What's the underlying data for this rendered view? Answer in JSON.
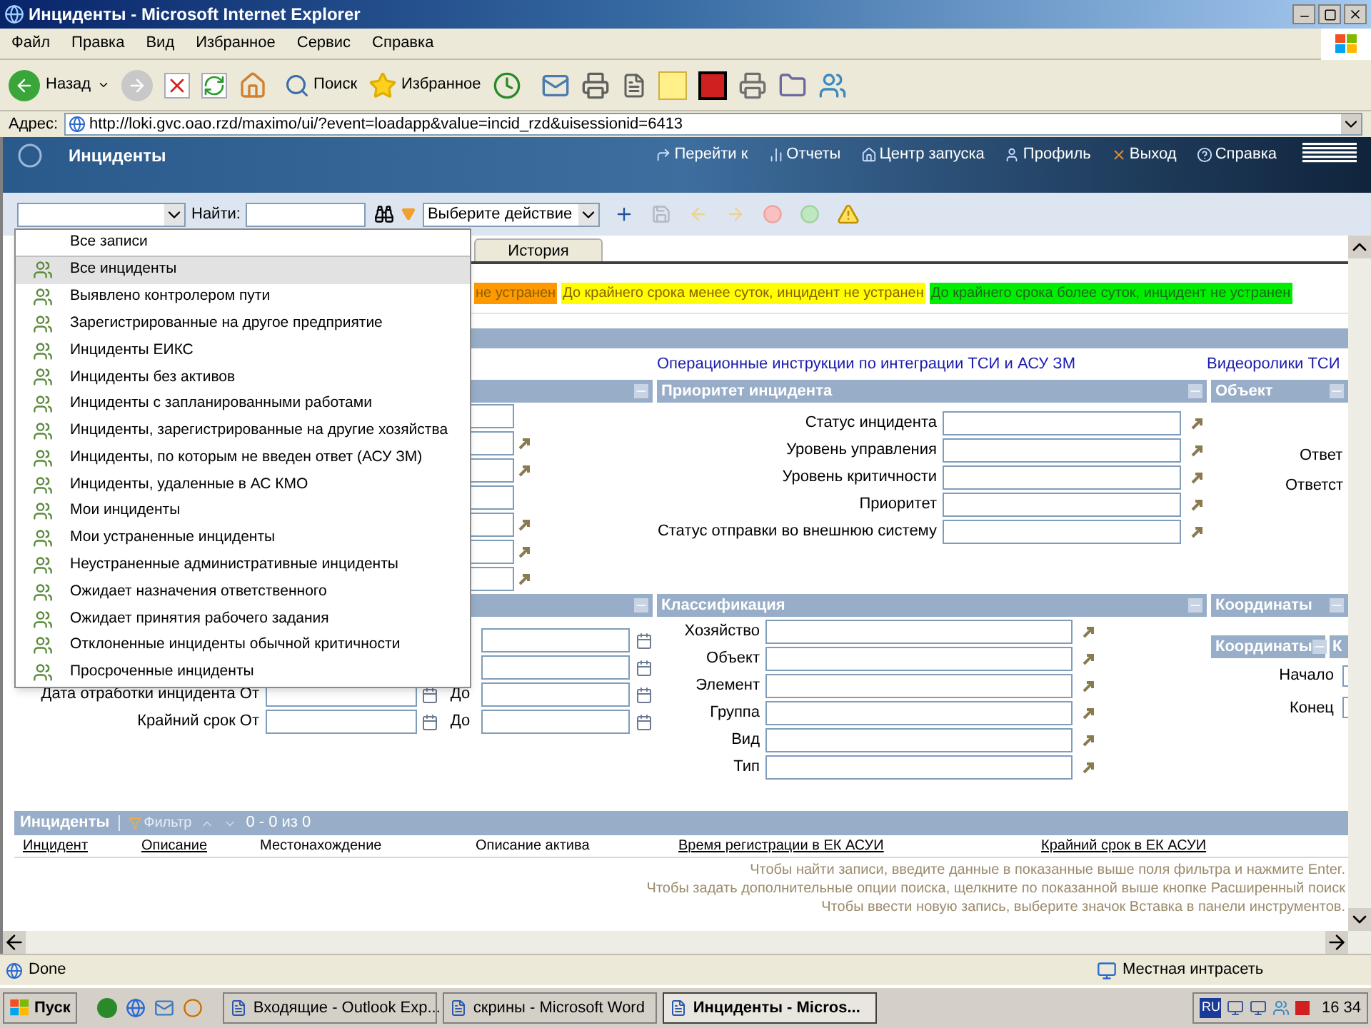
{
  "window": {
    "title": "Инциденты - Microsoft Internet Explorer"
  },
  "menu": [
    "Файл",
    "Правка",
    "Вид",
    "Избранное",
    "Сервис",
    "Справка"
  ],
  "ie_toolbar": {
    "back": "Назад",
    "search": "Поиск",
    "favorites": "Избранное"
  },
  "address": {
    "label": "Адрес:",
    "url": "http://loki.gvc.oao.rzd/maximo/ui/?event=loadapp&value=incid_rzd&uisessionid=6413"
  },
  "app_header": {
    "title": "Инциденты",
    "links": [
      {
        "label": "Перейти к",
        "kind": "goto"
      },
      {
        "label": "Отчеты",
        "kind": "reports"
      },
      {
        "label": "Центр запуска",
        "kind": "home"
      },
      {
        "label": "Профиль",
        "kind": "profile"
      },
      {
        "label": "Выход",
        "kind": "exit"
      },
      {
        "label": "Справка",
        "kind": "help"
      }
    ]
  },
  "app_toolbar": {
    "find_label": "Найти:",
    "action_select": "Выберите действие"
  },
  "tabs": [
    {
      "label": "История",
      "selected": false
    }
  ],
  "legend": [
    {
      "text": "не устранен",
      "color": "#ff9900"
    },
    {
      "text": "До крайнего срока менее суток, инцидент не устранен",
      "color": "#ffff00"
    },
    {
      "text": "До крайнего срока более суток, инцидент не устранен",
      "color": "#00ee00"
    }
  ],
  "links": [
    "Операционные инструкции по интеграции ТСИ и АСУ ЗМ",
    "Видеоролики ТСИ"
  ],
  "left_fields": [
    {
      "lookup": false
    },
    {
      "lookup": true
    },
    {
      "lookup": true
    },
    {
      "lookup": false
    },
    {
      "lookup": true
    },
    {
      "lookup": true
    },
    {
      "lookup": true
    }
  ],
  "priority_section": {
    "title": "Приоритет инцидента",
    "fields": [
      "Статус инцидента",
      "Уровень управления",
      "Уровень критичности",
      "Приоритет",
      "Статус отправки во внешнюю систему"
    ]
  },
  "object_section": {
    "title": "Объект",
    "labels": [
      "Ответ",
      "Ответст"
    ]
  },
  "date_rows": [
    {
      "kind": "partial"
    },
    {
      "kind": "partial"
    },
    {
      "kind": "range",
      "label": "Дата отработки инцидента От",
      "to": "До"
    },
    {
      "kind": "range",
      "label": "Крайний срок От",
      "to": "До"
    }
  ],
  "classification_section": {
    "title": "Классификация",
    "fields": [
      "Хозяйство",
      "Объект",
      "Элемент",
      "Группа",
      "Вид",
      "Тип"
    ]
  },
  "coordinates_section": {
    "title": "Координаты",
    "sub_title": "Координаты",
    "sub_title_2": "К",
    "labels": [
      "Начало",
      "Конец"
    ]
  },
  "list": {
    "title": "Инциденты",
    "filter": "Фильтр",
    "count": "0 - 0 из 0",
    "columns": [
      {
        "label": "Инцидент",
        "sortable": true
      },
      {
        "label": "Описание",
        "sortable": true
      },
      {
        "label": "Местонахождение",
        "sortable": false
      },
      {
        "label": "Описание актива",
        "sortable": false
      },
      {
        "label": "Время регистрации в ЕК АСУИ",
        "sortable": true
      },
      {
        "label": "Крайний срок в ЕК АСУИ",
        "sortable": true
      }
    ],
    "messages": [
      "Чтобы найти записи, введите данные в показанные выше поля фильтра и нажмите Enter.",
      "Чтобы задать дополнительные опции поиска, щелкните по показанной выше кнопке Расширенный поиск",
      "Чтобы ввести новую запись, выберите значок Вставка в панели инструментов."
    ]
  },
  "dropdown": {
    "items": [
      {
        "label": "Все записи",
        "kind": "plain",
        "selected": false
      },
      {
        "label": "Все инциденты",
        "kind": "query",
        "selected": true
      },
      {
        "label": "Выявлено контролером пути",
        "kind": "query",
        "selected": false
      },
      {
        "label": "Зарегистрированные на другое предприятие",
        "kind": "query",
        "selected": false
      },
      {
        "label": "Инциденты ЕИКС",
        "kind": "query",
        "selected": false
      },
      {
        "label": "Инциденты без активов",
        "kind": "query",
        "selected": false
      },
      {
        "label": "Инциденты с запланированными работами",
        "kind": "query",
        "selected": false
      },
      {
        "label": "Инциденты, зарегистрированные на другие хозяйства",
        "kind": "query",
        "selected": false
      },
      {
        "label": "Инциденты, по которым не введен ответ (АСУ ЗМ)",
        "kind": "query",
        "selected": false
      },
      {
        "label": "Инциденты, удаленные в АС КМО",
        "kind": "query",
        "selected": false
      },
      {
        "label": "Мои инциденты",
        "kind": "query",
        "selected": false
      },
      {
        "label": "Мои устраненные инциденты",
        "kind": "query",
        "selected": false
      },
      {
        "label": "Неустраненные административные инциденты",
        "kind": "query",
        "selected": false
      },
      {
        "label": "Ожидает назначения ответственного",
        "kind": "query",
        "selected": false
      },
      {
        "label": "Ожидает принятия рабочего задания",
        "kind": "query",
        "selected": false
      },
      {
        "label": "Отклоненные инциденты обычной критичности",
        "kind": "query",
        "selected": false
      },
      {
        "label": "Просроченные инциденты",
        "kind": "query",
        "selected": false
      }
    ]
  },
  "status_bar": {
    "text": "Done",
    "zone": "Местная интрасеть"
  },
  "taskbar": {
    "start": "Пуск",
    "tasks": [
      {
        "label": "Входящие - Outlook Exp...",
        "selected": false
      },
      {
        "label": "скрины - Microsoft Word",
        "selected": false
      },
      {
        "label": "Инциденты - Micros...",
        "selected": true
      }
    ],
    "lang": "RU",
    "clock": "16 34"
  }
}
